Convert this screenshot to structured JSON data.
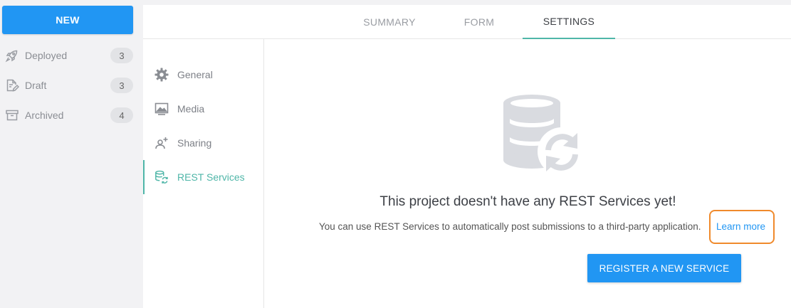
{
  "sidebar": {
    "new_label": "NEW",
    "items": [
      {
        "label": "Deployed",
        "count": "3",
        "icon": "rocket-icon"
      },
      {
        "label": "Draft",
        "count": "3",
        "icon": "draft-document-icon"
      },
      {
        "label": "Archived",
        "count": "4",
        "icon": "archive-box-icon"
      }
    ]
  },
  "tabs": [
    {
      "label": "SUMMARY",
      "active": false
    },
    {
      "label": "FORM",
      "active": false
    },
    {
      "label": "SETTINGS",
      "active": true
    }
  ],
  "settings_nav": [
    {
      "label": "General",
      "icon": "gear-icon",
      "active": false
    },
    {
      "label": "Media",
      "icon": "media-icon",
      "active": false
    },
    {
      "label": "Sharing",
      "icon": "add-user-icon",
      "active": false
    },
    {
      "label": "REST Services",
      "icon": "database-sync-icon",
      "active": true
    }
  ],
  "empty_state": {
    "icon": "database-sync-icon",
    "title": "This project doesn't have any REST Services yet!",
    "description": "You can use REST Services to automatically post submissions to a third-party application.",
    "learn_more": "Learn more",
    "register_button": "REGISTER A NEW SERVICE"
  },
  "colors": {
    "primary": "#2196f3",
    "accent": "#4fb6a8",
    "highlight": "#f08a2c"
  }
}
